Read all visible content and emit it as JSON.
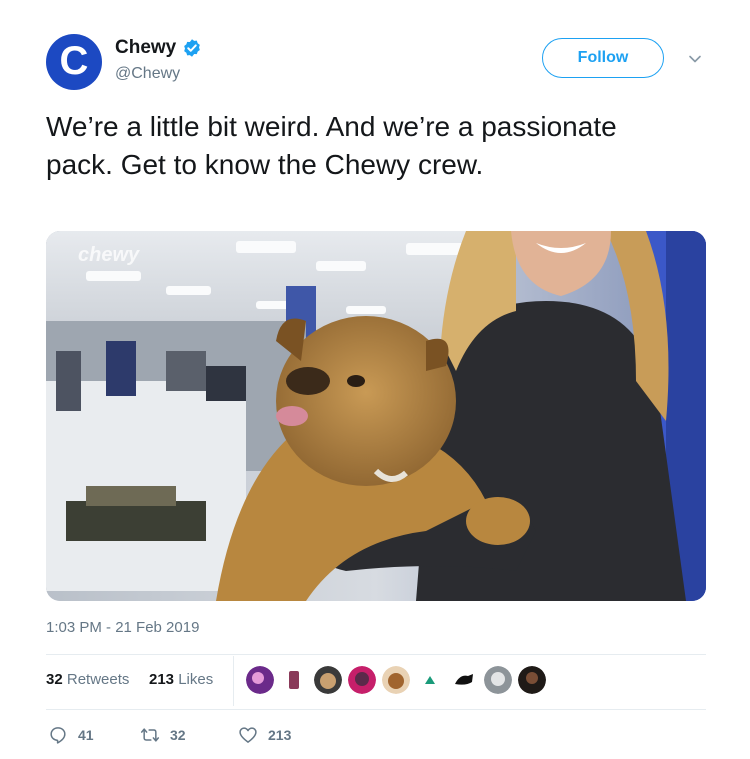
{
  "account": {
    "avatar_letter": "C",
    "name": "Chewy",
    "handle": "@Chewy",
    "verified": true
  },
  "follow_label": "Follow",
  "tweet_text": "We’re a little bit weird. And we’re a passionate pack. Get to know the Chewy crew.",
  "media": {
    "watermark": "chewy"
  },
  "timestamp": "1:03 PM - 21 Feb 2019",
  "stats": {
    "retweets_count": "32",
    "retweets_label": "Retweets",
    "likes_count": "213",
    "likes_label": "Likes"
  },
  "actions": {
    "reply_count": "41",
    "retweet_count": "32",
    "like_count": "213"
  },
  "colors": {
    "brand_blue": "#1c49c2",
    "link_blue": "#1da1f2",
    "muted_text": "#657786"
  }
}
